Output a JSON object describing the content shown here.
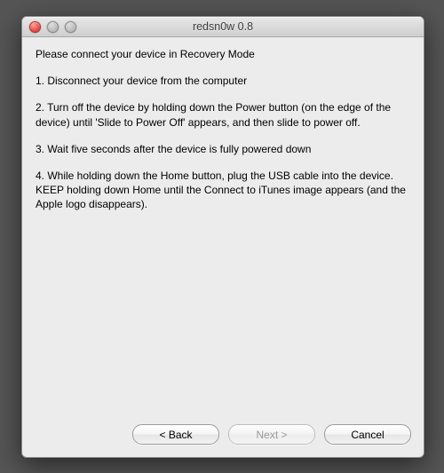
{
  "window": {
    "title": "redsn0w 0.8"
  },
  "content": {
    "heading": "Please connect your device in Recovery Mode",
    "step1": "1. Disconnect your device from the computer",
    "step2": "2. Turn off the device by holding down the Power button (on the edge of the device) until 'Slide to Power Off' appears, and then slide to power off.",
    "step3": "3. Wait five seconds after the device is fully powered down",
    "step4": "4. While holding down the Home button, plug the USB cable into the device. KEEP holding down Home until the Connect to iTunes image appears (and the Apple logo disappears)."
  },
  "buttons": {
    "back": "< Back",
    "next": "Next >",
    "cancel": "Cancel"
  }
}
